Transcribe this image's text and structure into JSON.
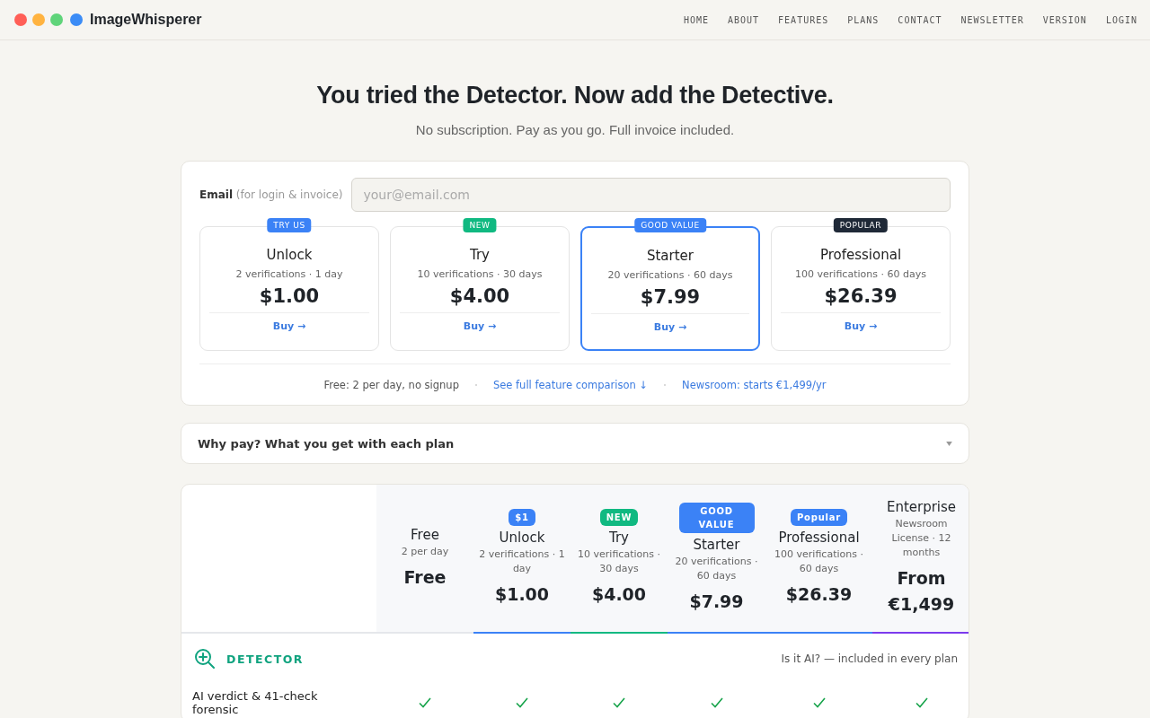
{
  "brand": {
    "name": "ImageWhisperer"
  },
  "nav": [
    "HOME",
    "ABOUT",
    "FEATURES",
    "PLANS",
    "CONTACT",
    "NEWSLETTER",
    "VERSION",
    "LOGIN"
  ],
  "hero": {
    "title": "You tried the Detector. Now add the Detective.",
    "subtitle": "No subscription. Pay as you go. Full invoice included."
  },
  "purchase": {
    "email_label": "Email",
    "email_hint": "(for login & invoice)",
    "email_placeholder": "your@email.com",
    "plans": [
      {
        "badge": "TRY US",
        "color": "#3b82f6",
        "name": "Unlock",
        "detail": "2 verifications · 1 day",
        "price": "$1.00",
        "action": "Buy →",
        "selected": false
      },
      {
        "badge": "NEW",
        "color": "#10b981",
        "name": "Try",
        "detail": "10 verifications · 30 days",
        "price": "$4.00",
        "action": "Buy →",
        "selected": false
      },
      {
        "badge": "GOOD VALUE",
        "color": "#3b82f6",
        "name": "Starter",
        "detail": "20 verifications · 60 days",
        "price": "$7.99",
        "action": "Buy →",
        "selected": true
      },
      {
        "badge": "POPULAR",
        "color": "#1f2937",
        "name": "Professional",
        "detail": "100 verifications · 60 days",
        "price": "$26.39",
        "action": "Buy →",
        "selected": false
      }
    ],
    "footer": [
      {
        "kind": "text",
        "text": "Free: 2 per day, no signup"
      },
      {
        "kind": "link",
        "text": "See full feature comparison ↓"
      },
      {
        "kind": "link",
        "text": "Newsroom: starts €1,499/yr"
      }
    ]
  },
  "accordion": {
    "title": "Why pay? What you get with each plan",
    "expanded": false
  },
  "comparison": {
    "columns": [
      {
        "name": "Free",
        "detail": "2 per day",
        "price": "Free"
      },
      {
        "badge": "$1",
        "color": "#3b82f6",
        "name": "Unlock",
        "detail": "2 verifications · 1 day",
        "price": "$1.00"
      },
      {
        "badge": "NEW",
        "color": "#10b981",
        "name": "Try",
        "detail": "10 verifications · 30 days",
        "price": "$4.00"
      },
      {
        "badge": "GOOD VALUE",
        "color": "#3b82f6",
        "name": "Starter",
        "detail": "20 verifications · 60 days",
        "price": "$7.99"
      },
      {
        "badge": "Popular",
        "color": "#3b82f6",
        "name": "Professional",
        "detail": "100 verifications · 60 days",
        "price": "$26.39"
      },
      {
        "name": "Enterprise",
        "color": "#7c3aed",
        "detail": "Newsroom License · 12 months",
        "price": "From €1,499"
      }
    ],
    "section": {
      "title": "DETECTOR",
      "note": "Is it AI? — included in every plan"
    },
    "rows": [
      {
        "label": "AI verdict & 41-check forensic",
        "included": [
          true,
          true,
          true,
          true,
          true,
          true
        ]
      }
    ]
  }
}
